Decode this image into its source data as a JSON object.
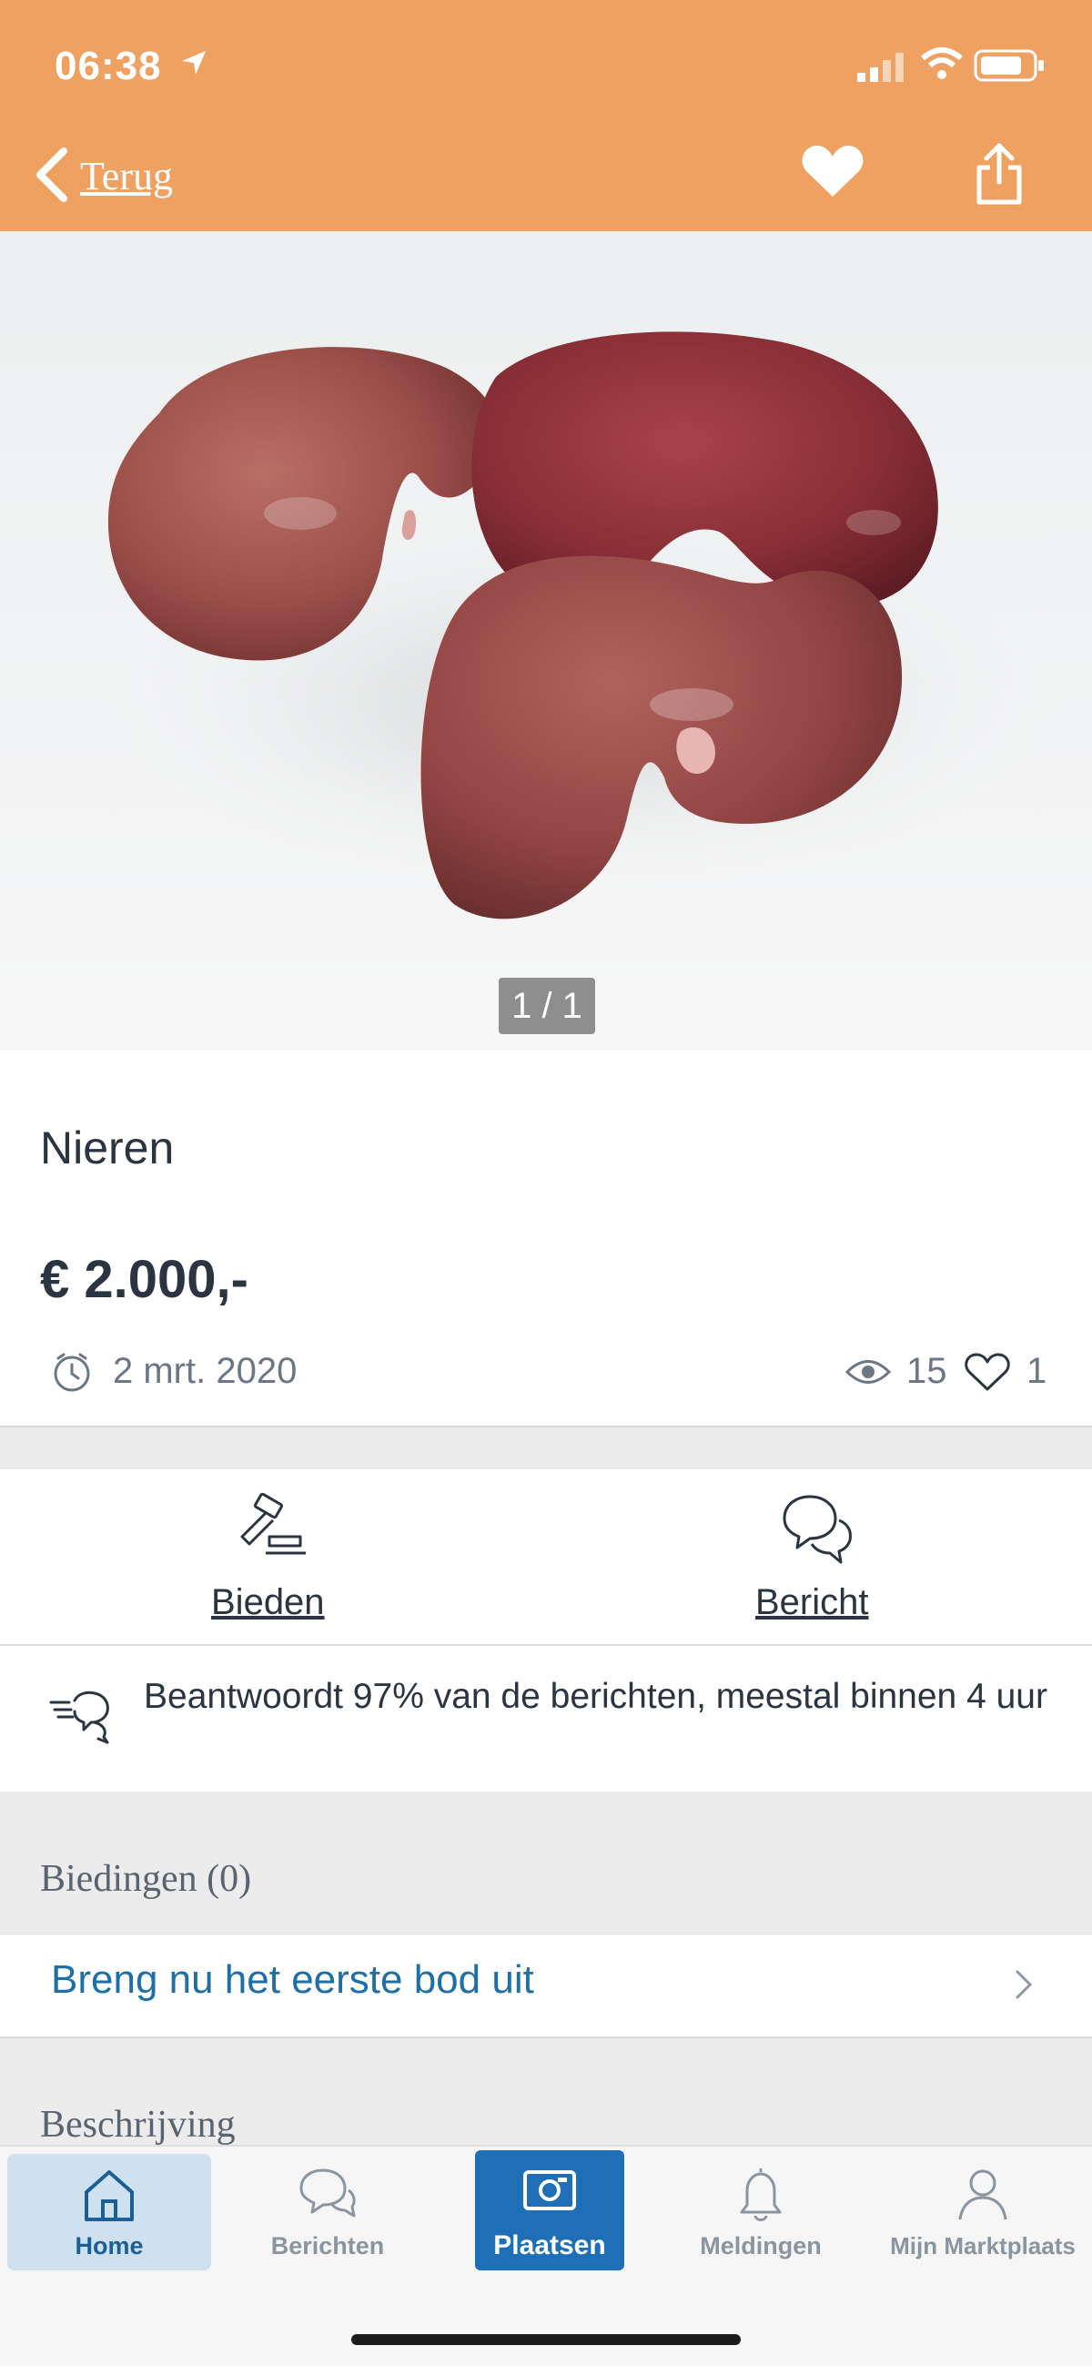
{
  "status_bar": {
    "time": "06:38"
  },
  "header": {
    "back_label": "Terug",
    "color": "#eea160"
  },
  "photo": {
    "subject": "three kidneys on white background",
    "counter": "1 / 1"
  },
  "listing": {
    "title": "Nieren",
    "price": "€ 2.000,-",
    "date": "2 mrt. 2020",
    "views": "15",
    "favorites": "1"
  },
  "actions": {
    "bid_label": "Bieden",
    "message_label": "Bericht",
    "response_text": "Beantwoordt 97% van de berichten, meestal binnen 4 uur"
  },
  "bids": {
    "header": "Biedingen (0)",
    "cta": "Breng nu het eerste bod uit"
  },
  "description": {
    "header": "Beschrijving"
  },
  "tabbar": {
    "tabs": [
      {
        "label": "Home",
        "icon": "home-icon",
        "active": true
      },
      {
        "label": "Berichten",
        "icon": "chat-icon"
      },
      {
        "label": "Plaatsen",
        "icon": "camera-icon",
        "highlight": true
      },
      {
        "label": "Meldingen",
        "icon": "bell-icon"
      },
      {
        "label": "Mijn Marktplaats",
        "icon": "user-icon"
      }
    ]
  },
  "colors": {
    "accent": "#eea160",
    "link": "#1e6fa5",
    "primary": "#1e6fb5",
    "text": "#2b3441"
  }
}
